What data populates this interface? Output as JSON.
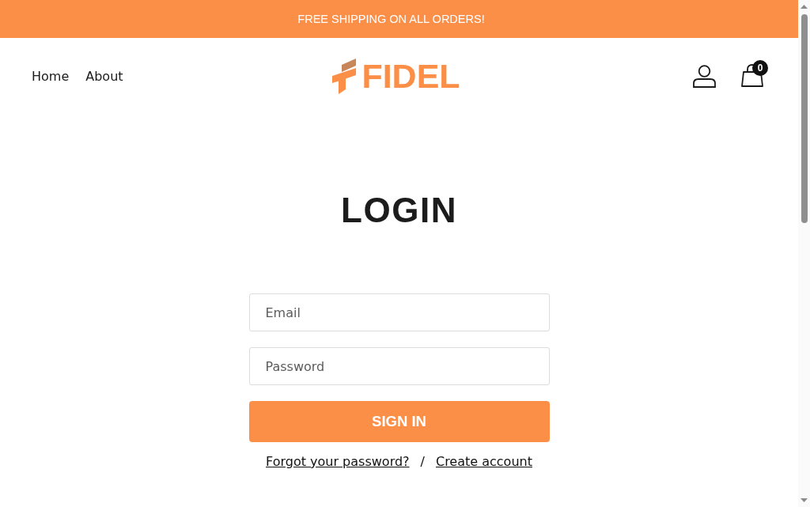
{
  "announcement_bar": {
    "text": "FREE SHIPPING ON ALL ORDERS!"
  },
  "header": {
    "nav": [
      {
        "label": "Home"
      },
      {
        "label": "About"
      }
    ],
    "logo": {
      "text": "FIDEL"
    },
    "cart": {
      "count": "0"
    }
  },
  "login": {
    "title": "LOGIN",
    "fields": [
      {
        "placeholder": "Email"
      },
      {
        "placeholder": "Password"
      }
    ],
    "submit": "SIGN IN",
    "links": [
      {
        "label": "Forgot your password?"
      },
      {
        "label": "Create account"
      }
    ],
    "separator": "/"
  }
}
